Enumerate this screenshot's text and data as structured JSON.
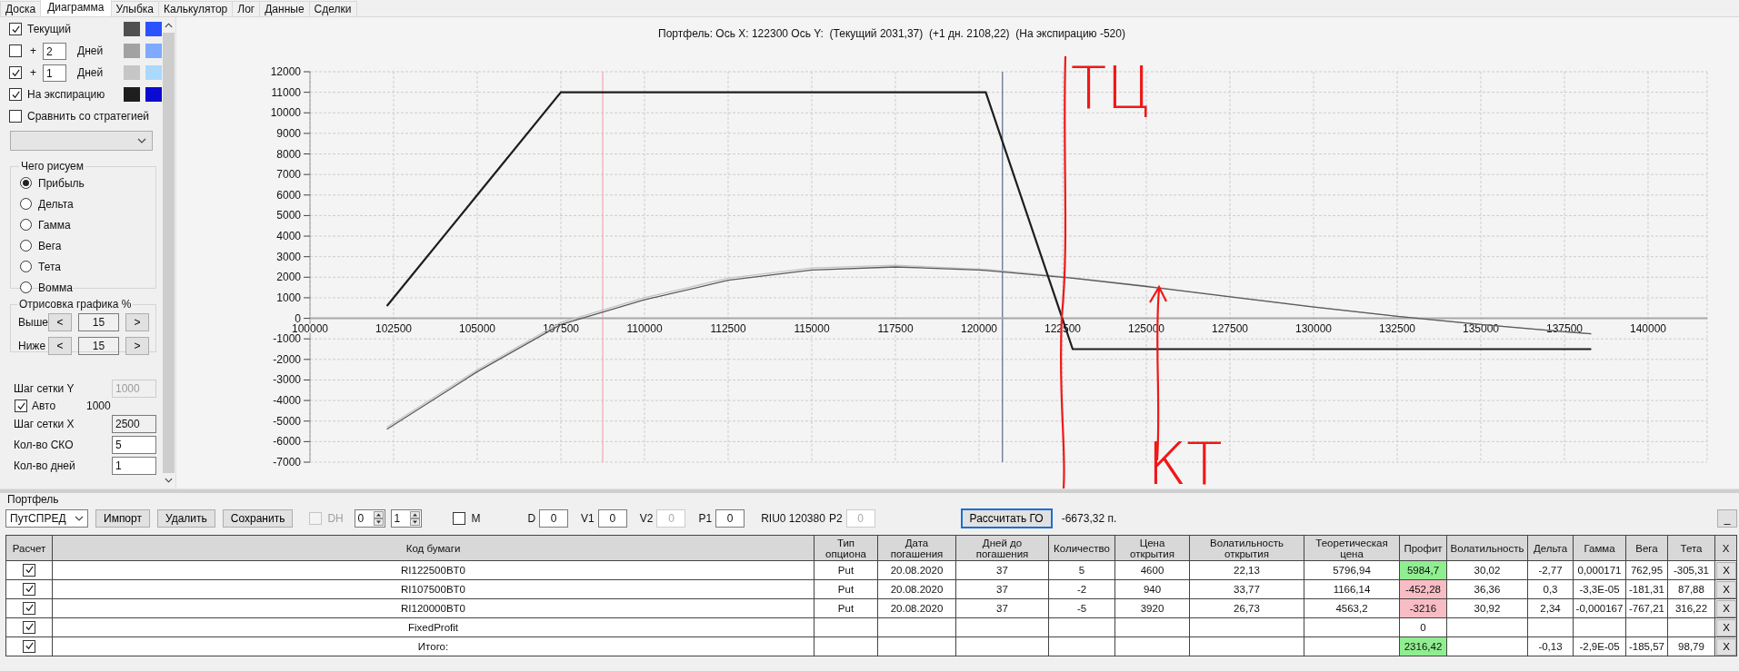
{
  "tabs": [
    {
      "label": "Доска",
      "selected": false
    },
    {
      "label": "Диаграмма",
      "selected": true
    },
    {
      "label": "Улыбка",
      "selected": false
    },
    {
      "label": "Калькулятор",
      "selected": false
    },
    {
      "label": "Лог",
      "selected": false
    },
    {
      "label": "Данные",
      "selected": false
    },
    {
      "label": "Сделки",
      "selected": false
    }
  ],
  "curves": [
    {
      "kind": "plain",
      "label": "Текущий",
      "checked": true,
      "swatches": [
        {
          "color": "#505050"
        },
        {
          "color": "#2a52ff"
        }
      ]
    },
    {
      "kind": "days",
      "sign": "+",
      "days": "2",
      "unit": "Дней",
      "checked": false,
      "swatches": [
        {
          "color": "#a2a2a2"
        },
        {
          "color": "#7eaaff"
        }
      ]
    },
    {
      "kind": "days",
      "sign": "+",
      "days": "1",
      "unit": "Дней",
      "checked": true,
      "swatches": [
        {
          "color": "#c6c6c6"
        },
        {
          "color": "#aad8ff"
        }
      ]
    },
    {
      "kind": "plain",
      "label": "На экспирацию",
      "checked": true,
      "swatches": [
        {
          "color": "#1e1e1e"
        },
        {
          "color": "#0a0ad2"
        }
      ]
    }
  ],
  "compare": {
    "label": "Сравнить со стратегией",
    "checked": false
  },
  "draw_group": {
    "title": "Чего рисуем",
    "options": [
      {
        "label": "Прибыль",
        "selected": true
      },
      {
        "label": "Дельта",
        "selected": false
      },
      {
        "label": "Гамма",
        "selected": false
      },
      {
        "label": "Вега",
        "selected": false
      },
      {
        "label": "Тета",
        "selected": false
      },
      {
        "label": "Вомма",
        "selected": false
      }
    ]
  },
  "range_group": {
    "title": "Отрисовка графика %",
    "rows": [
      {
        "label": "Выше",
        "dec": "<",
        "value": "15",
        "inc": ">"
      },
      {
        "label": "Ниже",
        "dec": "<",
        "value": "15",
        "inc": ">"
      }
    ]
  },
  "grid_y": {
    "label": "Шаг сетки Y",
    "value": "1000",
    "disabled": true
  },
  "auto": {
    "label": "Авто",
    "checked": true,
    "value": "1000"
  },
  "settings": [
    {
      "label": "Шаг сетки X",
      "value": "2500",
      "readonly": true
    },
    {
      "label": "Кол-во СКО",
      "value": "5",
      "readonly": false
    },
    {
      "label": "Кол-во дней",
      "value": "1",
      "readonly": false
    }
  ],
  "chart": {
    "chart_data": {
      "type": "line",
      "title": "Портфель: Ось X: 122300 Ось Y:  (Текущий 2031,37)  (+1 дн. 2108,22)  (На экспирацию -520)",
      "x": [
        102300,
        105000,
        107500,
        110000,
        112500,
        115000,
        117500,
        120000,
        120200,
        122500,
        122800,
        125000,
        127500,
        130000,
        132500,
        135000,
        137500,
        138300
      ],
      "series": [
        {
          "color": "#c4c4c4",
          "values": [
            -5300,
            -2500,
            -200,
            1000,
            1950,
            2450,
            2580,
            2400,
            2380,
            2030,
            1970,
            1570,
            1060,
            560,
            100,
            -300,
            -650,
            -750
          ]
        },
        {
          "color": "#5a5a5a",
          "values": [
            -5400,
            -2600,
            -300,
            900,
            1850,
            2350,
            2500,
            2350,
            2330,
            2000,
            1950,
            1550,
            1050,
            550,
            100,
            -300,
            -650,
            -750
          ]
        },
        {
          "color": "#1e1e1e",
          "values": [
            600,
            6000,
            11000,
            11000,
            11000,
            11000,
            11000,
            11000,
            11000,
            -60,
            -1500,
            -1500,
            -1500,
            -1500,
            -1500,
            -1500,
            -1500,
            -1500
          ]
        }
      ],
      "xlim": [
        100000,
        140000
      ],
      "ylim": [
        -7000,
        12000
      ],
      "grid": true,
      "xticks": [
        100000,
        102500,
        105000,
        107500,
        110000,
        112500,
        115000,
        117500,
        120000,
        122500,
        125000,
        127500,
        130000,
        132500,
        135000,
        137500,
        140000
      ],
      "yticks": [
        -7000,
        -6000,
        -5000,
        -4000,
        -3000,
        -2000,
        -1000,
        0,
        1000,
        2000,
        3000,
        4000,
        5000,
        6000,
        7000,
        8000,
        9000,
        10000,
        11000,
        12000
      ],
      "ref_lines": [
        {
          "axis": "x",
          "value": 108750,
          "color": "#f2a6b0"
        },
        {
          "axis": "x",
          "value": 120700,
          "color": "#5a6a88"
        }
      ]
    },
    "pen_marks": [
      {
        "text": "ТЦ"
      },
      {
        "text": "КТ"
      }
    ]
  },
  "portfolio": {
    "title": "Портфель",
    "strategy": "ПутСПРЕД",
    "buttons": [
      "Импорт",
      "Удалить",
      "Сохранить"
    ],
    "dh": {
      "label": "DH",
      "checked": false,
      "disabled": true
    },
    "spinners": [
      "0",
      "1"
    ],
    "m": {
      "label": "M",
      "checked": false
    },
    "items": [
      {
        "kind": "field",
        "label": "D",
        "value": "0",
        "disabled": false
      },
      {
        "kind": "field",
        "label": "V1",
        "value": "0",
        "disabled": false
      },
      {
        "kind": "field",
        "label": "V2",
        "value": "0",
        "disabled": true
      },
      {
        "kind": "field",
        "label": "P1",
        "value": "0",
        "disabled": false
      },
      {
        "kind": "text",
        "text": "RIU0 120380"
      },
      {
        "kind": "field",
        "label": "P2",
        "value": "0",
        "disabled": true
      }
    ],
    "calc_button": "Рассчитать ГО",
    "margin": "-6673,32 п.",
    "minimize": "_"
  },
  "table": {
    "columns": [
      {
        "title": "Расчет",
        "kind": "check"
      },
      {
        "title": "Код бумаги",
        "kind": "text"
      },
      {
        "title": "Тип опциона",
        "kind": "text"
      },
      {
        "title": "Дата погашения",
        "kind": "text"
      },
      {
        "title": "Дней до погашения",
        "kind": "text"
      },
      {
        "title": "Количество",
        "kind": "text"
      },
      {
        "title": "Цена открытия",
        "kind": "text"
      },
      {
        "title": "Волатильность открытия",
        "kind": "text"
      },
      {
        "title": "Теоретическая цена",
        "kind": "text"
      },
      {
        "title": "Профит",
        "kind": "text"
      },
      {
        "title": "Волатильность",
        "kind": "text"
      },
      {
        "title": "Дельта",
        "kind": "text"
      },
      {
        "title": "Гамма",
        "kind": "text"
      },
      {
        "title": "Вега",
        "kind": "text"
      },
      {
        "title": "Тета",
        "kind": "text"
      },
      {
        "title": "X",
        "kind": "button"
      }
    ],
    "rows": [
      {
        "cells": [
          {
            "checked": true
          },
          "RI122500BT0",
          "Put",
          "20.08.2020",
          "37",
          "5",
          "4600",
          "22,13",
          "5796,94",
          {
            "text": "5984,7",
            "color": "#90ee90"
          },
          "30,02",
          "-2,77",
          "0,000171",
          "762,95",
          "-305,31",
          "X"
        ]
      },
      {
        "cells": [
          {
            "checked": true
          },
          "RI107500BT0",
          "Put",
          "20.08.2020",
          "37",
          "-2",
          "940",
          "33,77",
          "1166,14",
          {
            "text": "-452,28",
            "color": "#f7bcc4"
          },
          "36,36",
          "0,3",
          "-3,3E-05",
          "-181,31",
          "87,88",
          "X"
        ]
      },
      {
        "cells": [
          {
            "checked": true
          },
          "RI120000BT0",
          "Put",
          "20.08.2020",
          "37",
          "-5",
          "3920",
          "26,73",
          "4563,2",
          {
            "text": "-3216",
            "color": "#f7bcc4"
          },
          "30,92",
          "2,34",
          "-0,000167",
          "-767,21",
          "316,22",
          "X"
        ]
      },
      {
        "cells": [
          {
            "checked": true
          },
          "FixedProfit",
          null,
          null,
          null,
          null,
          null,
          null,
          null,
          "0",
          null,
          null,
          null,
          null,
          null,
          "X"
        ]
      },
      {
        "cells": [
          {
            "checked": true
          },
          "Итого:",
          null,
          null,
          null,
          null,
          null,
          null,
          null,
          {
            "text": "2316,42",
            "color": "#90ee90"
          },
          null,
          "-0,13",
          "-2,9E-05",
          "-185,57",
          "98,79",
          "X"
        ]
      }
    ]
  }
}
